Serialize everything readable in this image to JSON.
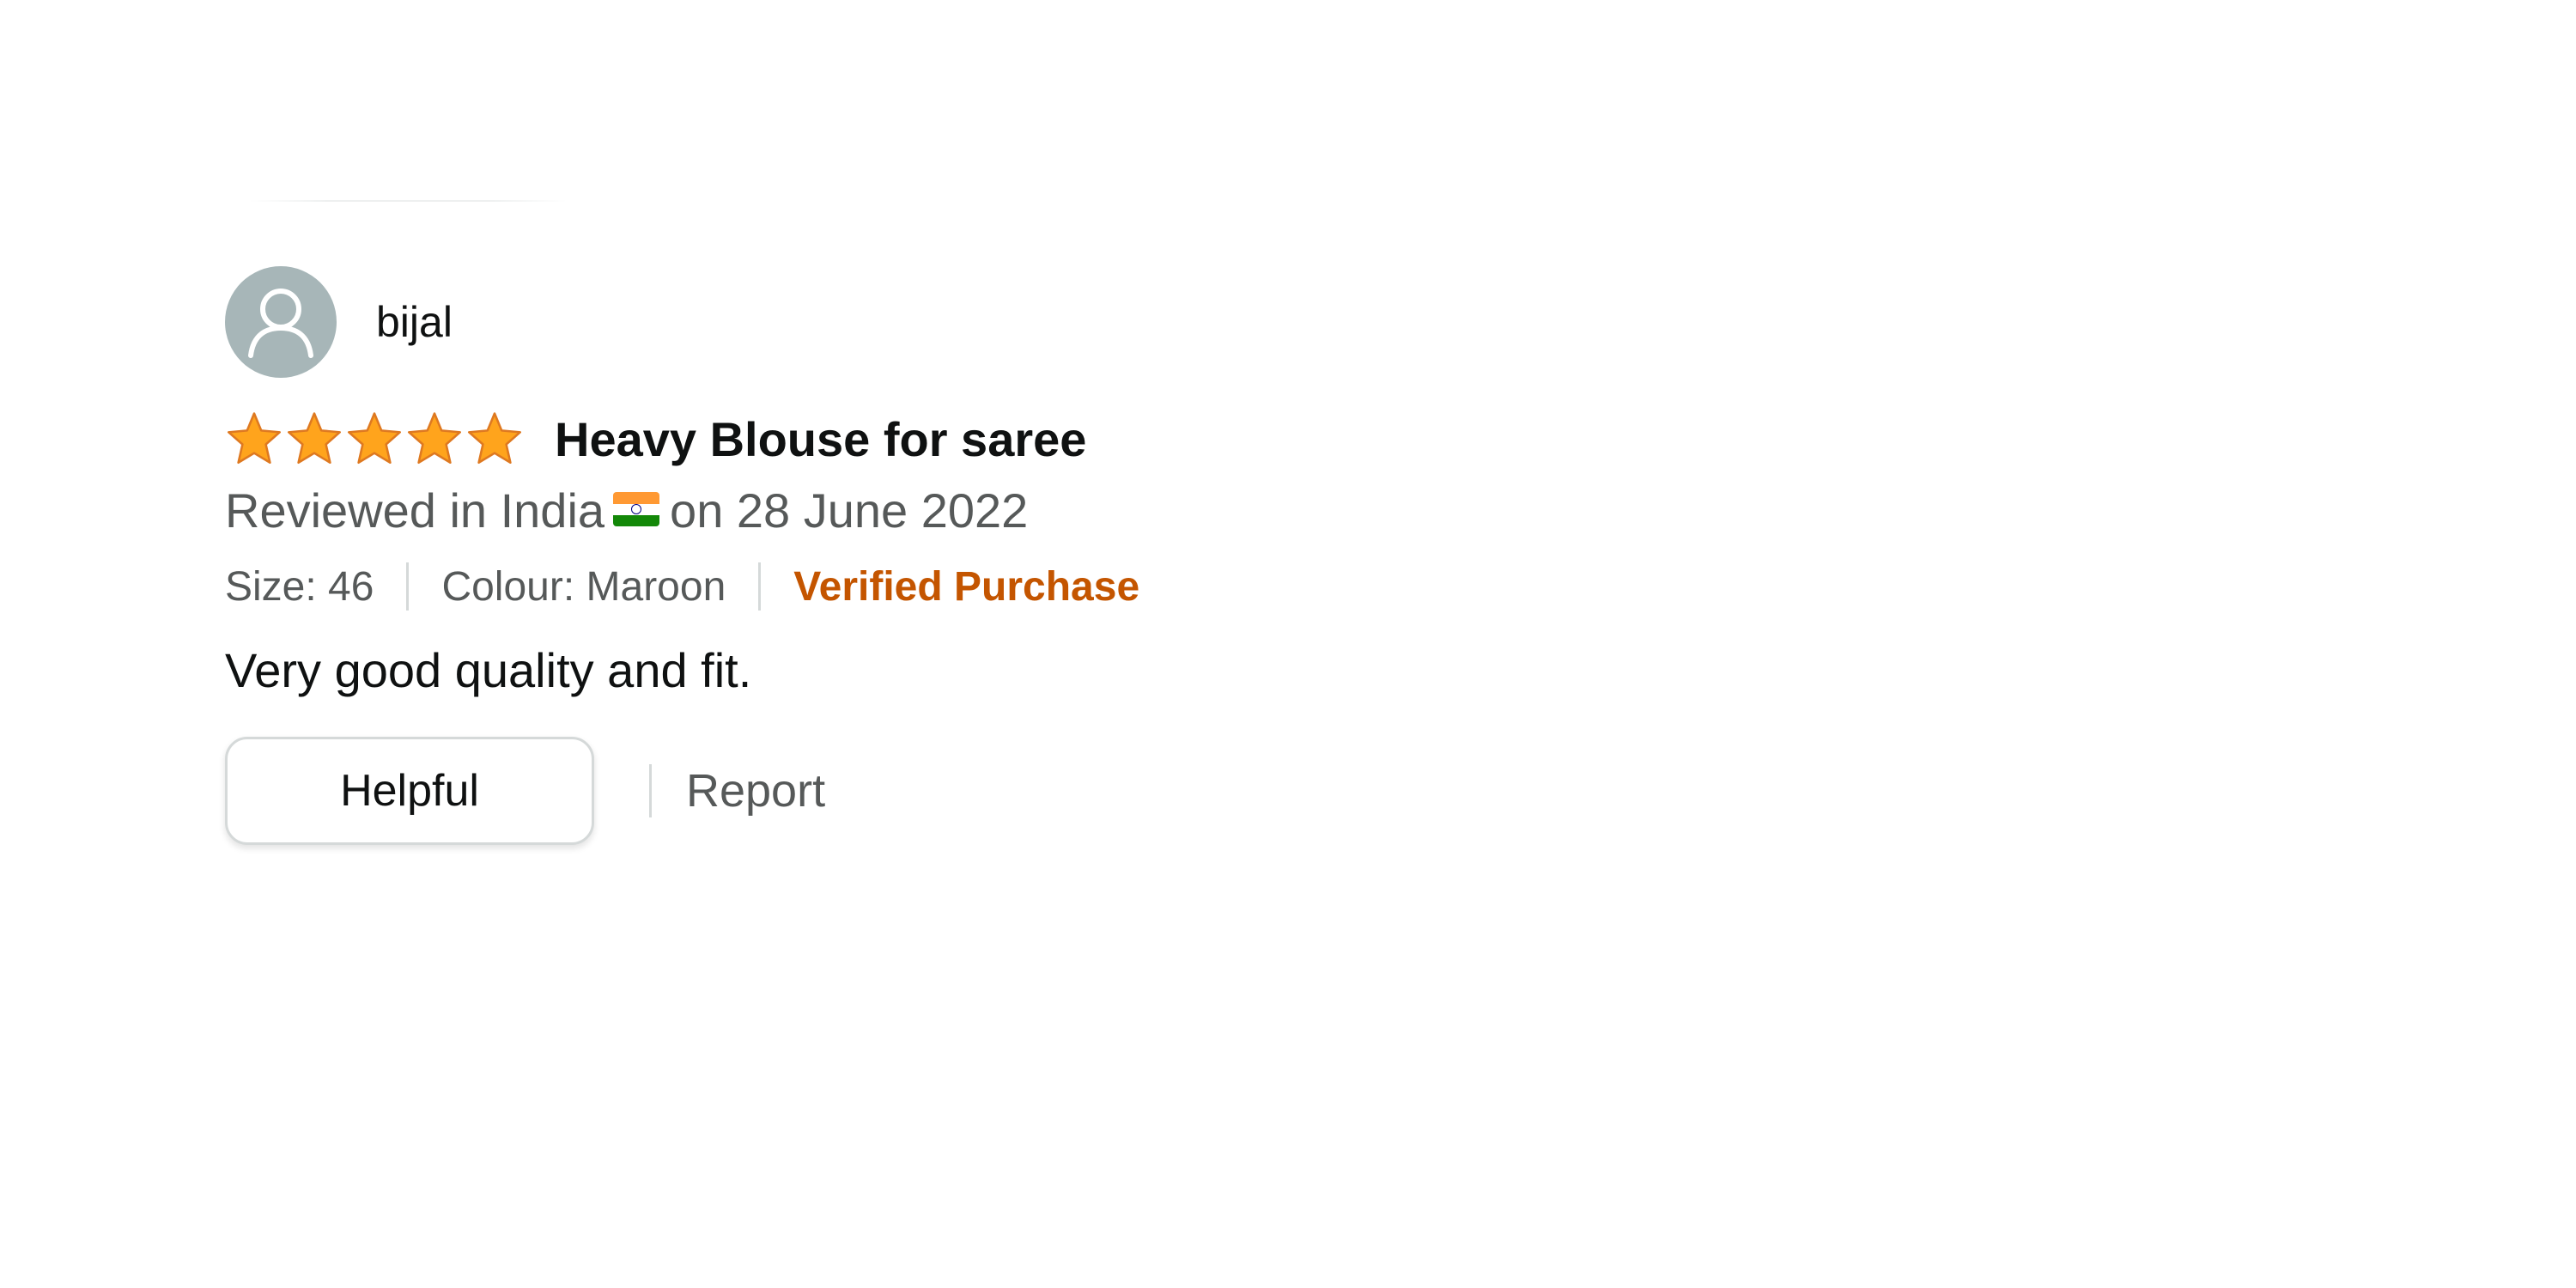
{
  "reviewer": {
    "name": "bijal",
    "avatar_icon": "default-user-avatar-icon"
  },
  "review": {
    "rating": 5,
    "rating_max": 5,
    "star_color": "#ffa41c",
    "title": "Heavy Blouse for saree",
    "date_prefix": "Reviewed in India",
    "flag_icon": "india-flag-icon",
    "date_suffix": "on 28 June 2022",
    "size": "Size: 46",
    "colour": "Colour: Maroon",
    "verified": "Verified Purchase",
    "verified_color": "#c45500",
    "body": "Very good quality and fit."
  },
  "actions": {
    "helpful_label": "Helpful",
    "report_label": "Report"
  }
}
